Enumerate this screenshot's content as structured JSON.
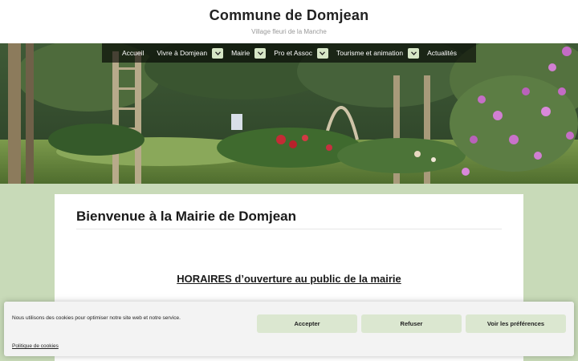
{
  "site": {
    "title": "Commune de Domjean",
    "tagline": "Village fleuri de la Manche"
  },
  "nav": {
    "items": [
      {
        "label": "Accueil",
        "has_dropdown": false
      },
      {
        "label": "Vivre à Domjean",
        "has_dropdown": true
      },
      {
        "label": "Mairie",
        "has_dropdown": true
      },
      {
        "label": "Pro et Assoc",
        "has_dropdown": true
      },
      {
        "label": "Tourisme et animation",
        "has_dropdown": true
      },
      {
        "label": "Actualités",
        "has_dropdown": false
      }
    ],
    "dropdown_icon": "chevron-down-icon"
  },
  "hero": {
    "image": "garden-photo"
  },
  "content": {
    "title": "Bienvenue à la Mairie de Domjean",
    "hours_heading": "HORAIRES d’ouverture au public de la mairie"
  },
  "cookie_banner": {
    "message": "Nous utilisons des cookies pour optimiser notre site web et notre service.",
    "accept_label": "Accepter",
    "refuse_label": "Refuser",
    "preferences_label": "Voir les préférences",
    "policy_link": "Politique de cookies"
  },
  "colors": {
    "page_background": "#c8dab8",
    "nav_background": "#1f1f1f",
    "dropdown_button": "#d6e6c6",
    "cookie_button": "#dbe7d0",
    "cookie_background": "#f3f3f3"
  }
}
